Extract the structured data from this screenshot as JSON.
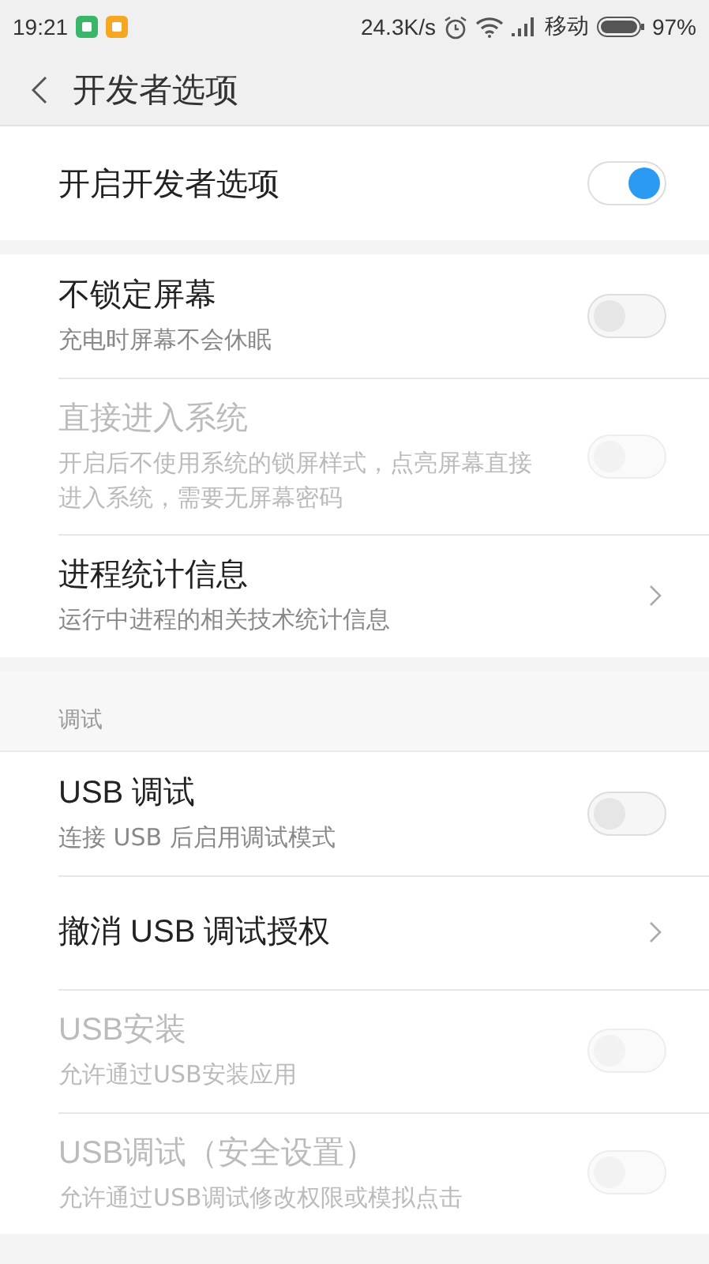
{
  "status_bar": {
    "time": "19:21",
    "speed": "24.3K/s",
    "carrier": "移动",
    "battery": "97%"
  },
  "header": {
    "title": "开发者选项"
  },
  "sections": [
    {
      "items": [
        {
          "kind": "toggle",
          "title": "开启开发者选项",
          "on": true,
          "disabled": false
        }
      ]
    },
    {
      "items": [
        {
          "kind": "toggle",
          "title": "不锁定屏幕",
          "subtitle": "充电时屏幕不会休眠",
          "on": false,
          "disabled": false
        },
        {
          "kind": "toggle",
          "title": "直接进入系统",
          "subtitle": "开启后不使用系统的锁屏样式，点亮屏幕直接进入系统，需要无屏幕密码",
          "on": false,
          "disabled": true
        },
        {
          "kind": "arrow",
          "title": "进程统计信息",
          "subtitle": "运行中进程的相关技术统计信息",
          "disabled": false
        }
      ]
    },
    {
      "heading": "调试",
      "items": [
        {
          "kind": "toggle",
          "title": "USB 调试",
          "subtitle": "连接 USB 后启用调试模式",
          "on": false,
          "disabled": false
        },
        {
          "kind": "arrow",
          "title": "撤消 USB 调试授权",
          "disabled": false
        },
        {
          "kind": "toggle",
          "title": "USB安装",
          "subtitle": "允许通过USB安装应用",
          "on": false,
          "disabled": true
        },
        {
          "kind": "toggle",
          "title": "USB调试（安全设置）",
          "subtitle": "允许通过USB调试修改权限或模拟点击",
          "on": false,
          "disabled": true
        }
      ]
    }
  ]
}
